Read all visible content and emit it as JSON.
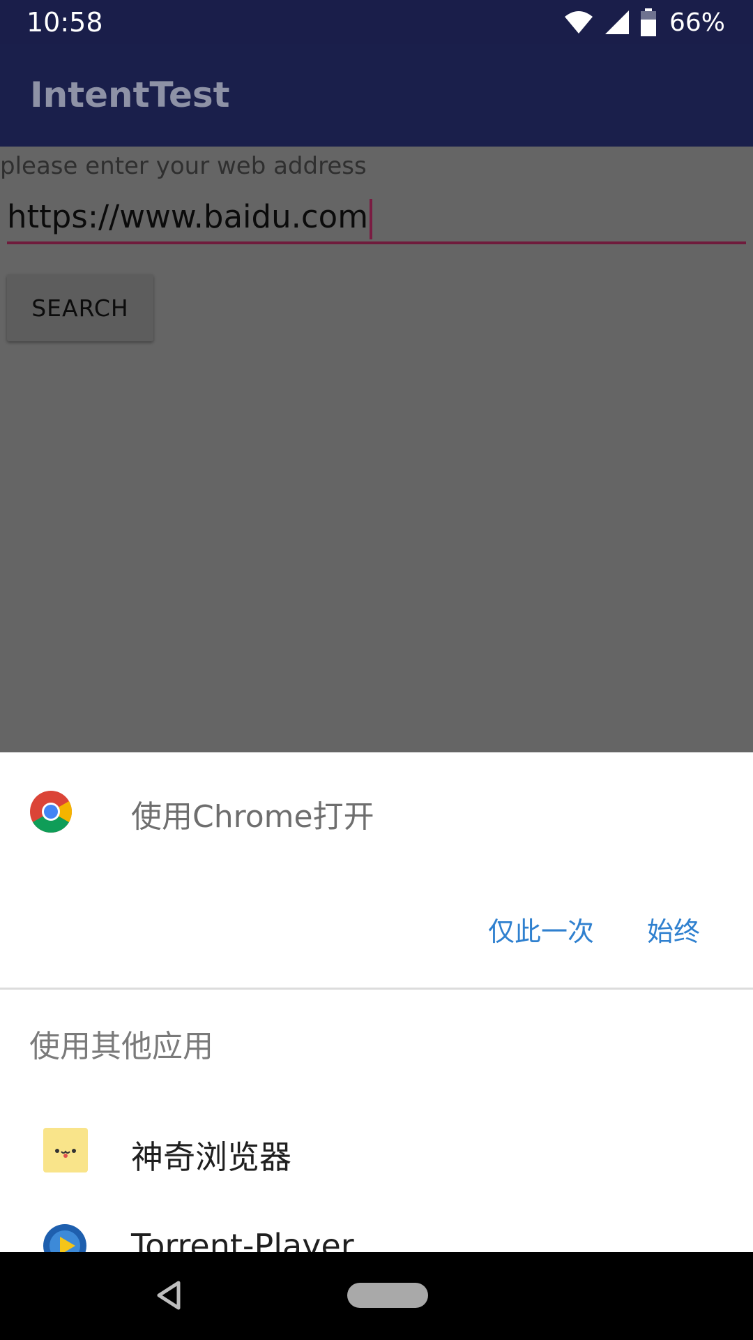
{
  "status_bar": {
    "time": "10:58",
    "battery_percent": "66%",
    "icons": [
      "wifi-icon",
      "cell-signal-icon",
      "battery-icon"
    ]
  },
  "app_bar": {
    "title": "IntentTest"
  },
  "form": {
    "label": "please enter your web address",
    "url_value": "https://www.baidu.com",
    "search_label": "SEARCH"
  },
  "chooser": {
    "default_app_title": "使用Chrome打开",
    "default_app_icon": "chrome-icon",
    "once_label": "仅此一次",
    "always_label": "始终",
    "other_apps_heading": "使用其他应用",
    "apps": [
      {
        "label": "神奇浏览器",
        "icon": "magic-browser-icon"
      },
      {
        "label": "Torrent-Player",
        "icon": "torrent-player-icon"
      }
    ]
  },
  "nav_bar": {
    "icons": [
      "back-icon",
      "home-icon"
    ]
  },
  "colors": {
    "status_bar": "#1a1e4a",
    "app_bar": "#1a1f4b",
    "scrim_content": "#656565",
    "input_underline": "#6f1b3c",
    "accent_text": "#2f80cf",
    "sheet_background": "#ffffff"
  }
}
